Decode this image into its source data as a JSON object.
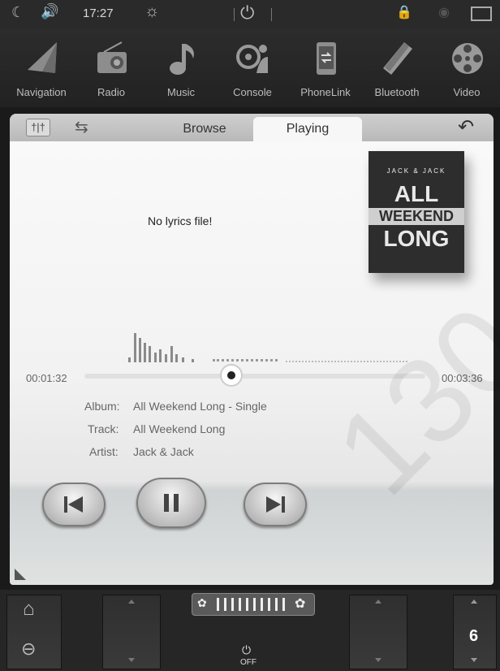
{
  "status_bar": {
    "time": "17:27",
    "icons": [
      "moon-icon",
      "volume-icon",
      "brightness-icon",
      "power-icon",
      "lock-icon",
      "wifi-icon",
      "window-icon"
    ]
  },
  "apps": [
    {
      "label": "Navigation",
      "icon": "navigation-icon"
    },
    {
      "label": "Radio",
      "icon": "radio-icon"
    },
    {
      "label": "Music",
      "icon": "music-icon"
    },
    {
      "label": "Console",
      "icon": "console-icon"
    },
    {
      "label": "PhoneLink",
      "icon": "phonelink-icon"
    },
    {
      "label": "Bluetooth",
      "icon": "bluetooth-icon"
    },
    {
      "label": "Video",
      "icon": "video-icon"
    }
  ],
  "tabs": {
    "browse": "Browse",
    "playing": "Playing"
  },
  "lyrics": "No lyrics file!",
  "album_art": {
    "line1": "JACK & JACK",
    "line2": "ALL",
    "line3": "WEEKEND",
    "line4": "LONG"
  },
  "playback": {
    "elapsed": "00:01:32",
    "total": "00:03:36",
    "progress": 0.43
  },
  "meta": {
    "album_label": "Album:",
    "album_value": "All Weekend Long - Single",
    "track_label": "Track:",
    "track_value": "All Weekend Long",
    "artist_label": "Artist:",
    "artist_value": "Jack & Jack"
  },
  "bottom": {
    "off_label": "OFF",
    "temp_value": "6"
  },
  "watermark": "130"
}
